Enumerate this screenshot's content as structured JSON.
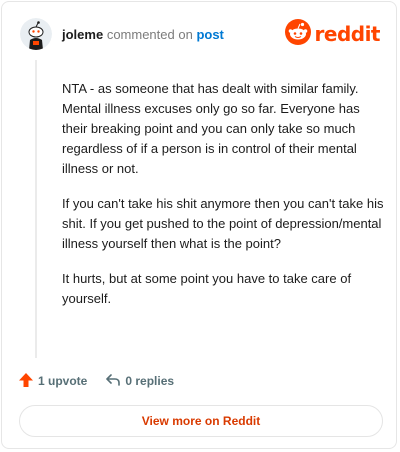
{
  "header": {
    "username": "joleme",
    "commented_text": "commented on",
    "post_link": "post",
    "logo_text": "reddit"
  },
  "comment": {
    "paragraphs": [
      "NTA - as someone that has dealt with similar family. Mental illness excuses only go so far. Everyone has their breaking point and you can only take so much regardless of if a person is in control of their mental illness or not.",
      "If you can't take his shit anymore then you can't take his shit. If you get pushed to the point of depression/mental illness yourself then what is the point?",
      "It hurts, but at some point you have to take care of yourself."
    ]
  },
  "actions": {
    "upvote_label": "1 upvote",
    "replies_label": "0 replies"
  },
  "footer": {
    "view_more_label": "View more on Reddit"
  },
  "colors": {
    "brand": "#ff4500",
    "link": "#0079d3",
    "view_more": "#d93a00"
  },
  "icons": [
    "snoo-avatar",
    "reddit-logo-icon",
    "upvote-arrow-icon",
    "reply-icon"
  ]
}
